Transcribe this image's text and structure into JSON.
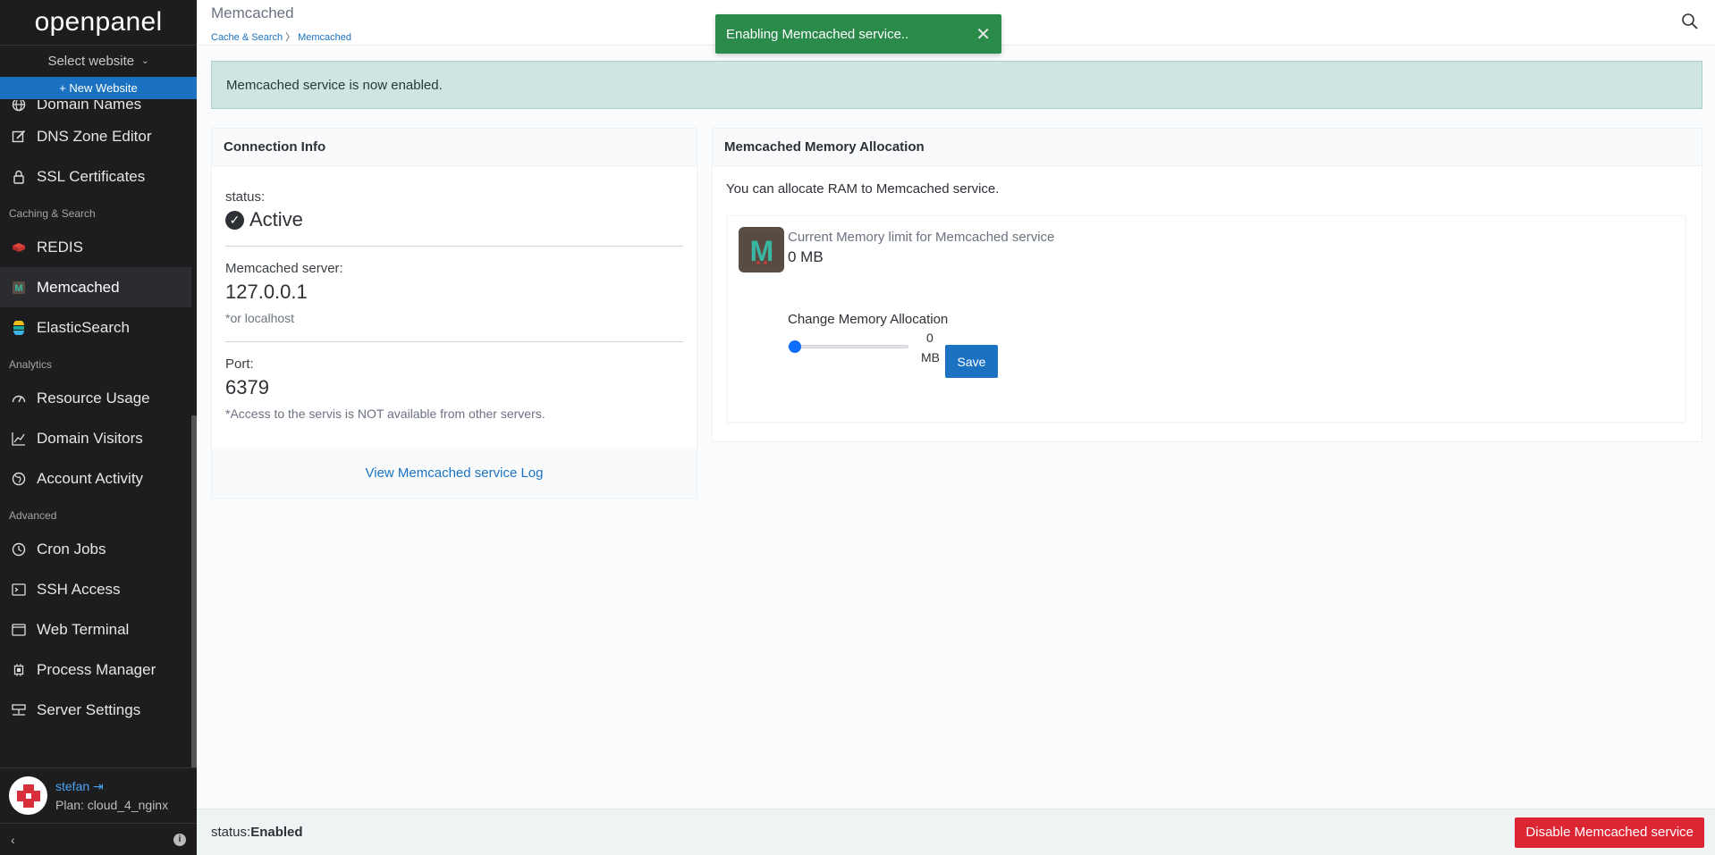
{
  "sidebar": {
    "brand": "openpanel",
    "site_select": "Select website",
    "new_website": "+ New Website",
    "items_top": [
      {
        "label": "Domain Names",
        "icon": "globe-icon"
      },
      {
        "label": "DNS Zone Editor",
        "icon": "edit-icon"
      },
      {
        "label": "SSL Certificates",
        "icon": "lock-icon"
      }
    ],
    "section_caching": "Caching & Search",
    "items_caching": [
      {
        "label": "REDIS",
        "icon": "redis-icon"
      },
      {
        "label": "Memcached",
        "icon": "memcached-icon"
      },
      {
        "label": "ElasticSearch",
        "icon": "elasticsearch-icon"
      }
    ],
    "section_analytics": "Analytics",
    "items_analytics": [
      {
        "label": "Resource Usage",
        "icon": "gauge-icon"
      },
      {
        "label": "Domain Visitors",
        "icon": "chart-line-icon"
      },
      {
        "label": "Account Activity",
        "icon": "globe-icon"
      }
    ],
    "section_advanced": "Advanced",
    "items_advanced": [
      {
        "label": "Cron Jobs",
        "icon": "clock-icon"
      },
      {
        "label": "SSH Access",
        "icon": "terminal-icon"
      },
      {
        "label": "Web Terminal",
        "icon": "terminal-window-icon"
      },
      {
        "label": "Process Manager",
        "icon": "cpu-icon"
      },
      {
        "label": "Server Settings",
        "icon": "server-icon"
      }
    ],
    "user": {
      "name": "stefan",
      "plan": "Plan: cloud_4_nginx"
    }
  },
  "header": {
    "title": "Memcached",
    "breadcrumb": [
      "Cache & Search",
      "Memcached"
    ]
  },
  "toast": {
    "message": "Enabling Memcached service.."
  },
  "alert": {
    "message": "Memcached service is now enabled."
  },
  "connection": {
    "title": "Connection Info",
    "status_label": "status:",
    "status_value": "Active",
    "server_label": "Memcached server:",
    "server_value": "127.0.0.1",
    "server_note": "*or localhost",
    "port_label": "Port:",
    "port_value": "6379",
    "port_note": "*Access to the servis is NOT available from other servers.",
    "log_link": "View Memcached service Log"
  },
  "memory": {
    "title": "Memcached Memory Allocation",
    "intro": "You can allocate RAM to Memcached service.",
    "limit_label": "Current Memory limit for Memcached service",
    "limit_value": "0 MB",
    "change_label": "Change Memory Allocation",
    "slider_value": "0",
    "slider_unit": "MB",
    "save_label": "Save"
  },
  "footer": {
    "status_label": "status:",
    "status_value": "Enabled",
    "disable_label": "Disable Memcached service"
  },
  "colors": {
    "primary": "#1b72c2",
    "danger": "#dc2634",
    "success_toast": "#2a8a4a",
    "sidebar_bg": "#1d1d20"
  }
}
